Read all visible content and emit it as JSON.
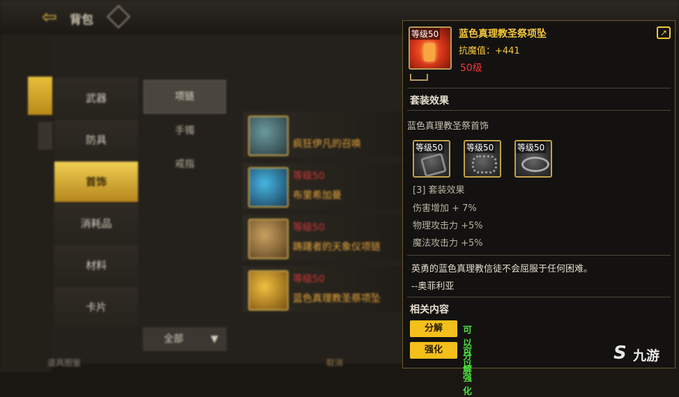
{
  "background": {
    "title": "背包",
    "categories": [
      {
        "label": "武器",
        "active": false
      },
      {
        "label": "防具",
        "active": false
      },
      {
        "label": "首饰",
        "active": true
      },
      {
        "label": "消耗品",
        "active": false
      },
      {
        "label": "材料",
        "active": false
      },
      {
        "label": "卡片",
        "active": false
      }
    ],
    "subcategories": [
      {
        "label": "项链",
        "active": true
      },
      {
        "label": "手镯",
        "active": false
      },
      {
        "label": "戒指",
        "active": false
      }
    ],
    "items": [
      {
        "level": "",
        "name": "疯狂伊凡的召唤"
      },
      {
        "level": "等级50",
        "name": "布里希加曼"
      },
      {
        "level": "等级50",
        "name": "踌躇者的天象仪项链"
      },
      {
        "level": "等级50",
        "name": "蓝色真理教圣祭项坠"
      }
    ],
    "filter_label": "全部",
    "bottom_left": "道具图鉴",
    "bottom_mid": "取消"
  },
  "tooltip": {
    "icon_level_tag": "等级50",
    "item_name": "蓝色真理教圣祭项坠",
    "stat_line": "抗魔值：+441",
    "required_level": "50级",
    "set_section_title": "套装效果",
    "set_name": "蓝色真理教圣祭首饰",
    "set_icons": [
      {
        "level_tag": "等级50",
        "icon": "bracelet-icon"
      },
      {
        "level_tag": "等级50",
        "icon": "ring-band-icon"
      },
      {
        "level_tag": "等级50",
        "icon": "ring-icon"
      }
    ],
    "set_effect_header": "[3] 套装效果",
    "set_effects": [
      "伤害增加 + 7%",
      "物理攻击力 +5%",
      "魔法攻击力 +5%"
    ],
    "flavor_text": "英勇的蓝色真理教信徒不会屈服于任何困难。",
    "flavor_author": "--奥菲利亚",
    "related_title": "相关内容",
    "actions": [
      {
        "button": "分解",
        "note": "可以分解"
      },
      {
        "button": "强化",
        "note": "可以强化"
      }
    ]
  },
  "colors": {
    "gold_accent": "#f4c73c",
    "required_red": "#ff3535",
    "ok_green": "#49e03a",
    "button_yellow": "#f3bf1a"
  }
}
